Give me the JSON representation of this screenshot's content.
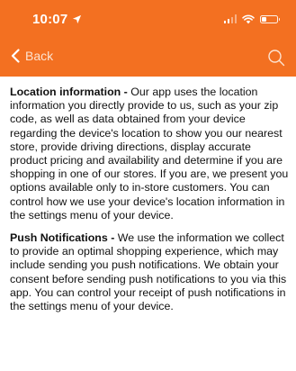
{
  "status_bar": {
    "time": "10:07",
    "location_icon": "location-arrow-icon",
    "signal_icon": "cellular-signal-icon",
    "wifi_icon": "wifi-icon",
    "battery_icon": "battery-icon",
    "battery_level": 0.3
  },
  "nav": {
    "back_label": "Back",
    "back_icon": "chevron-left-icon",
    "search_icon": "search-icon"
  },
  "colors": {
    "header_bg": "#f37021",
    "text": "#111111"
  },
  "sections": [
    {
      "title": "Location information - ",
      "body": "Our app uses the location information you directly provide to us, such as your zip code, as well as data obtained from your device regarding the device's location to show you our nearest store, provide driving directions, display accurate product pricing and availability and determine if you are shopping in one of our stores. If you are, we present you options available only to in-store customers. You can control how we use your device's location information in the settings menu of your device."
    },
    {
      "title": "Push Notifications - ",
      "body": "We use the information we collect to provide an optimal shopping experience, which may include sending you push notifications. We obtain your consent before sending push notifications to you via this app. You can control your receipt of push notifications in the settings menu of your device."
    }
  ]
}
